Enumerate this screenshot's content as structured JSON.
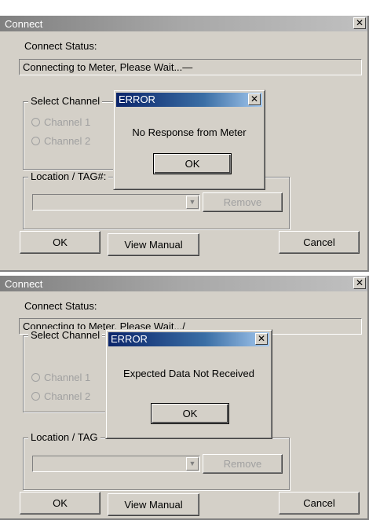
{
  "windows": [
    {
      "title": "Connect",
      "status_label": "Connect Status:",
      "status_text": "Connecting to Meter, Please Wait...—",
      "select_channel_label": "Select Channel",
      "channel1": "Channel 1",
      "channel2": "Channel 2",
      "location_label": "Location / TAG#:",
      "remove_label": "Remove",
      "ok_label": "OK",
      "view_manual_label": "View Manual",
      "cancel_label": "Cancel",
      "error": {
        "title": "ERROR",
        "message": "No Response from Meter",
        "ok_label": "OK"
      }
    },
    {
      "title": "Connect",
      "status_label": "Connect Status:",
      "status_text": "Connecting to Meter, Please Wait.../",
      "select_channel_label": "Select Channel",
      "channel1": "Channel 1",
      "channel2": "Channel 2",
      "location_label": "Location / TAG",
      "remove_label": "Remove",
      "ok_label": "OK",
      "view_manual_label": "View Manual",
      "cancel_label": "Cancel",
      "error": {
        "title": "ERROR",
        "message": "Expected Data Not Received",
        "ok_label": "OK"
      }
    }
  ],
  "icons": {
    "close": "close-icon",
    "dropdown": "chevron-down-icon"
  }
}
